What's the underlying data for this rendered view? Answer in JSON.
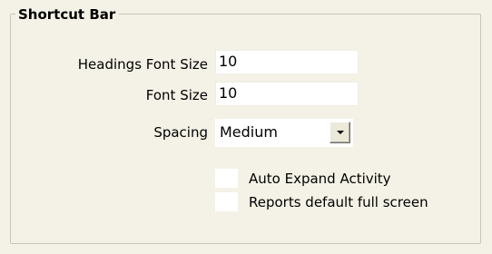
{
  "group": {
    "title": "Shortcut Bar"
  },
  "fields": {
    "headings_font_size": {
      "label": "Headings Font Size",
      "value": "10"
    },
    "font_size": {
      "label": "Font Size",
      "value": "10"
    },
    "spacing": {
      "label": "Spacing",
      "selected": "Medium"
    }
  },
  "checkboxes": {
    "auto_expand_activity": {
      "label": "Auto Expand Activity",
      "checked": false
    },
    "reports_default_full_screen": {
      "label": "Reports default full screen",
      "checked": false
    }
  },
  "icons": {
    "dropdown": "chevron-down-icon"
  }
}
